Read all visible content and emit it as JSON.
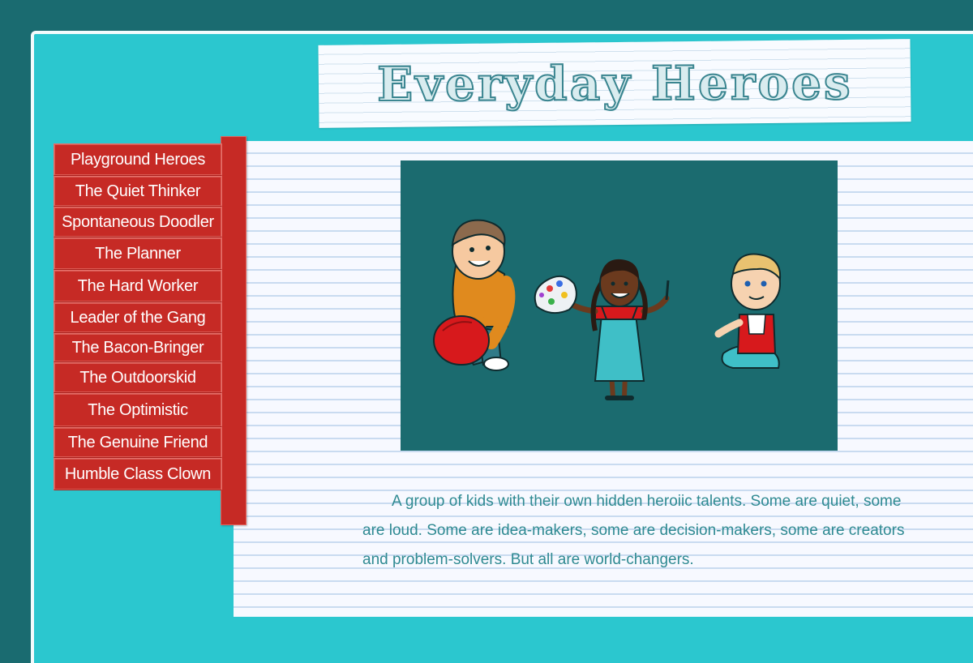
{
  "header": {
    "title": "Everyday Heroes"
  },
  "nav": {
    "items": [
      {
        "label": "Playground Heroes"
      },
      {
        "label": "The Quiet Thinker"
      },
      {
        "label": "Spontaneous Doodler"
      },
      {
        "label": "The Planner"
      },
      {
        "label": "The Hard Worker"
      },
      {
        "label": "Leader of the Gang"
      },
      {
        "label": "The Bacon-Bringer"
      },
      {
        "label": "The Outdoorskid"
      },
      {
        "label": "The Optimistic"
      },
      {
        "label": "The Genuine Friend"
      },
      {
        "label": "Humble Class Clown"
      }
    ]
  },
  "main": {
    "description": "A group of kids with their own hidden heroiic talents. Some are quiet, some are loud. Some are idea-makers, some are decision-makers, some are creators and problem-solvers. But all are world-changers."
  },
  "colors": {
    "page_background": "#1a6b70",
    "frame_background": "#2bc7cf",
    "menu_red": "#c62a25",
    "illustration_background": "#1b6b6f",
    "description_text": "#2f8a92"
  }
}
